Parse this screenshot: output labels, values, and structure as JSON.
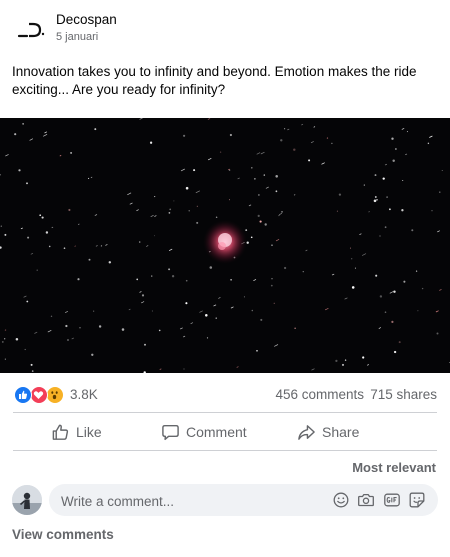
{
  "post": {
    "page_name": "Decospan",
    "date": "5 januari",
    "caption": "Innovation takes you to infinity and beyond. Emotion makes the ride exciting... Are you ready for infinity?"
  },
  "engagement": {
    "reactions": [
      "like-icon",
      "love-icon",
      "wow-icon"
    ],
    "reaction_count": "3.8K",
    "comments": "456 comments",
    "shares": "715 shares"
  },
  "actions": {
    "like": "Like",
    "comment": "Comment",
    "share": "Share"
  },
  "comments": {
    "sort_label": "Most relevant",
    "composer_placeholder": "Write a comment...",
    "composer_icons": [
      "emoji-icon",
      "camera-icon",
      "gif-icon",
      "sticker-icon"
    ],
    "view_comments": "View comments"
  },
  "colors": {
    "like_blue": "#1877f2",
    "love_red": "#f33e58",
    "wow_yellow": "#f7b125",
    "secondary_text": "#65676b",
    "video_background": "#050507"
  }
}
